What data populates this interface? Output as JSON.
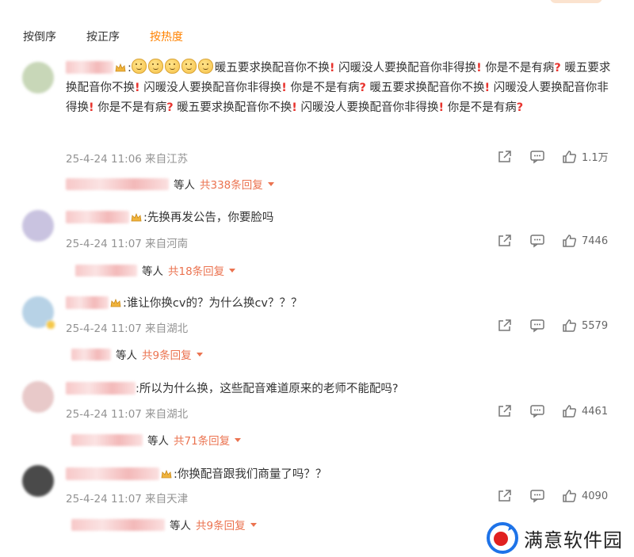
{
  "sort_tabs": [
    {
      "label": "按倒序",
      "active": false
    },
    {
      "label": "按正序",
      "active": false
    },
    {
      "label": "按热度",
      "active": true
    }
  ],
  "colors": {
    "accent": "#ff8200",
    "reply": "#eb7350",
    "alert": "#e8332d",
    "meta": "#939393"
  },
  "comments": [
    {
      "avatar_color": "#c8d7b8",
      "text_parts": [
        ":",
        "EMOJIx5",
        "暖五要求换配音你不换",
        "!",
        " 闪暖没人要换配音你非得换",
        "!",
        " 你是不是有病",
        "?",
        " 暖五要求换配音你不换",
        "!",
        " 闪暖没人要换配音你非得换",
        "!",
        " 你是不是有病",
        "?",
        " 暖五要求换配音你不换",
        "!",
        " 闪暖没人要换配音你非得换",
        "!",
        " 你是不是有病",
        "?",
        " 暖五要求换配音你不换",
        "!",
        " 闪暖没人要换配音你非得换",
        "!",
        " 你是不是有病",
        "?"
      ],
      "time": "25-4-24 11:06 来自江苏",
      "likes": "1.1万",
      "reply_suffix": "等人",
      "reply_count": "共338条回复"
    },
    {
      "avatar_color": "#c9c3e0",
      "text": ":先换再发公告，你要脸吗",
      "time": "25-4-24 11:07 来自河南",
      "likes": "7446",
      "reply_suffix": "等人",
      "reply_count": "共18条回复"
    },
    {
      "avatar_color": "#b7d2e6",
      "text": ":谁让你换cv的？为什么换cv？？？",
      "time": "25-4-24 11:07 来自湖北",
      "likes": "5579",
      "reply_suffix": "等人",
      "reply_count": "共9条回复"
    },
    {
      "avatar_color": "#e8c9c9",
      "text": ":所以为什么换，这些配音难道原来的老师不能配吗?",
      "time": "25-4-24 11:07 来自湖北",
      "likes": "4461",
      "reply_suffix": "等人",
      "reply_count": "共71条回复"
    },
    {
      "avatar_color": "#4a4a4a",
      "text": ":你换配音跟我们商量了吗？？",
      "time": "25-4-24 11:07 来自天津",
      "likes": "4090",
      "reply_suffix": "等人",
      "reply_count": "共9条回复"
    }
  ],
  "watermark": {
    "text": "满意软件园",
    "icon": "brand-logo-icon"
  }
}
